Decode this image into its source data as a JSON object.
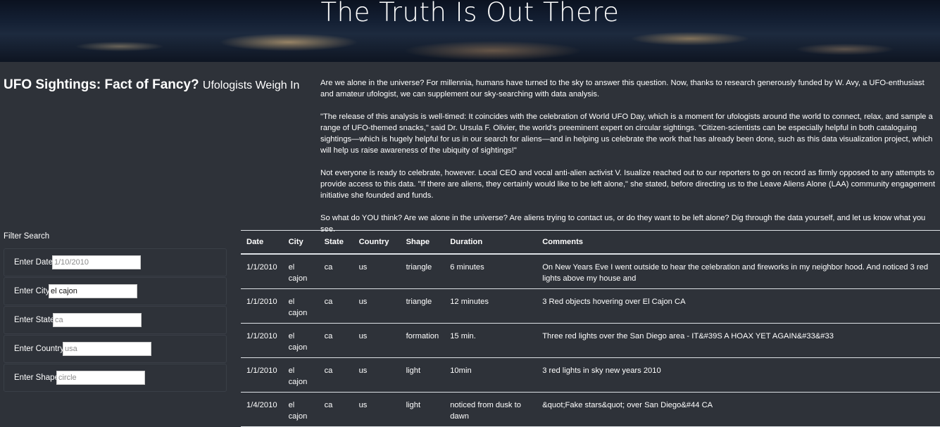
{
  "hero": {
    "title": "The Truth Is Out There"
  },
  "headline": {
    "main": "UFO Sightings: Fact of Fancy?",
    "sub": "Ufologists Weigh In"
  },
  "intro": {
    "paragraphs": [
      "Are we alone in the universe? For millennia, humans have turned to the sky to answer this question. Now, thanks to research generously funded by W. Avy, a UFO-enthusiast and amateur ufologist, we can supplement our sky-searching with data analysis.",
      "\"The release of this analysis is well-timed: It coincides with the celebration of World UFO Day, which is a moment for ufologists around the world to connect, relax, and sample a range of UFO-themed snacks,\" said Dr. Ursula F. Olivier, the world's preeminent expert on circular sightings. \"Citizen-scientists can be especially helpful in both cataloguing sightings—which is hugely helpful for us in our search for aliens—and in helping us celebrate the work that has already been done, such as this data visualization project, which will help us raise awareness of the ubiquity of sightings!\"",
      "Not everyone is ready to celebrate, however. Local CEO and vocal anti-alien activist V. Isualize reached out to our reporters to go on record as firmly opposed to any attempts to provide access to this data. \"If there are aliens, they certainly would like to be left alone,\" she stated, before directing us to the Leave Aliens Alone (LAA) community engagement initiative she founded and funds.",
      "So what do YOU think? Are we alone in the universe? Are aliens trying to contact us, or do they want to be left alone? Dig through the data yourself, and let us know what you see."
    ]
  },
  "filters": {
    "heading": "Filter Search",
    "date": {
      "label": "Enter Date",
      "placeholder": "1/10/2010"
    },
    "city": {
      "label": "Enter City",
      "value": "el cajon"
    },
    "state": {
      "label": "Enter State",
      "placeholder": "ca"
    },
    "country": {
      "label": "Enter Country",
      "placeholder": "usa"
    },
    "shape": {
      "label": "Enter Shape",
      "placeholder": "circle"
    }
  },
  "table": {
    "headers": [
      "Date",
      "City",
      "State",
      "Country",
      "Shape",
      "Duration",
      "Comments"
    ],
    "rows": [
      [
        "1/1/2010",
        "el cajon",
        "ca",
        "us",
        "triangle",
        "6 minutes",
        "On New Years Eve I went outside to hear the celebration and fireworks in my neighbor hood. And noticed 3 red lights above my house and"
      ],
      [
        "1/1/2010",
        "el cajon",
        "ca",
        "us",
        "triangle",
        "12 minutes",
        "3 Red objects hovering over El Cajon CA"
      ],
      [
        "1/1/2010",
        "el cajon",
        "ca",
        "us",
        "formation",
        "15 min.",
        "Three red lights over the San Diego area - IT&#39S A HOAX YET AGAIN&#33&#33"
      ],
      [
        "1/1/2010",
        "el cajon",
        "ca",
        "us",
        "light",
        "10min",
        "3 red lights in sky new years 2010"
      ],
      [
        "1/4/2010",
        "el cajon",
        "ca",
        "us",
        "light",
        "noticed from dusk to dawn",
        "&quot;Fake stars&quot; over San Diego&#44 CA"
      ]
    ]
  }
}
